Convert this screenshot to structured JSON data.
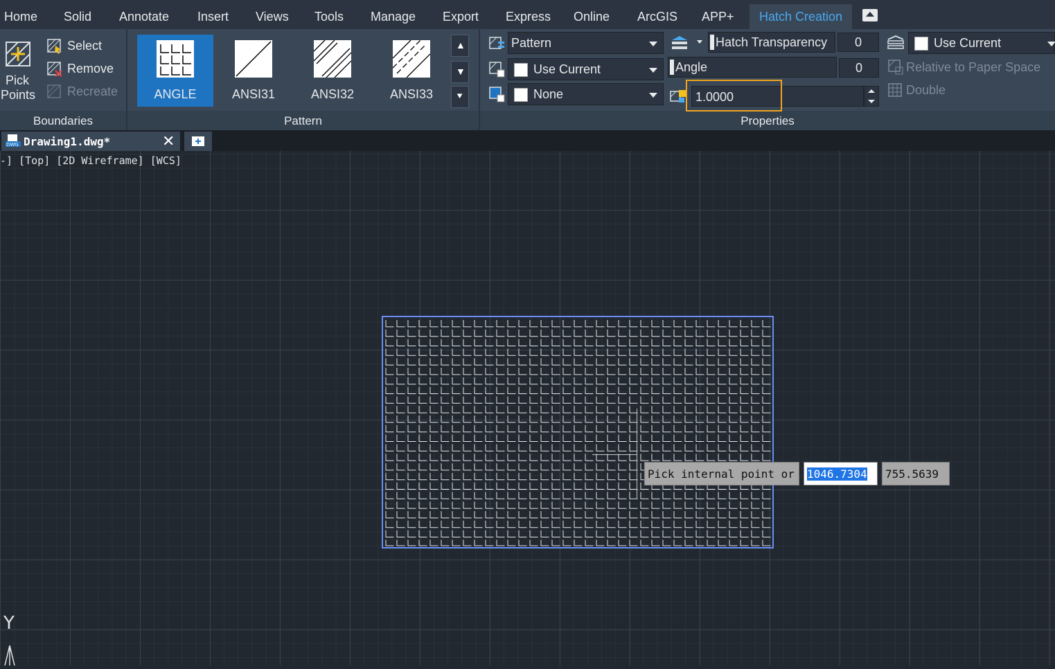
{
  "menu": {
    "items": [
      "Home",
      "Solid",
      "Annotate",
      "Insert",
      "Views",
      "Tools",
      "Manage",
      "Export",
      "Express",
      "Online",
      "ArcGIS",
      "APP+",
      "Hatch Creation"
    ],
    "active": "Hatch Creation"
  },
  "boundaries": {
    "title": "Boundaries",
    "pick_points_line1": "Pick",
    "pick_points_line2": "Points",
    "select": "Select",
    "remove": "Remove",
    "recreate": "Recreate"
  },
  "pattern": {
    "title": "Pattern",
    "tiles": [
      "ANGLE",
      "ANSI31",
      "ANSI32",
      "ANSI33"
    ],
    "selected": "ANGLE"
  },
  "properties": {
    "title": "Properties",
    "hatch_type": "Pattern",
    "hatch_color": "Use Current",
    "background_color": "None",
    "transparency_label": "Hatch Transparency",
    "transparency_value": "0",
    "angle_label": "Angle",
    "angle_value": "0",
    "scale_value": "1.0000",
    "layer": "Use Current",
    "relative_to_paper": "Relative to Paper Space",
    "double": "Double"
  },
  "document": {
    "tab_name": "Drawing1.dwg*",
    "viewport_label": "-] [Top] [2D Wireframe] [WCS]"
  },
  "command": {
    "prompt": "Pick internal point or",
    "x": "1046.7304",
    "y": "755.5639"
  },
  "ucs": {
    "y_label": "Y"
  },
  "colors": {
    "accent": "#1f74c2",
    "active_tab_text": "#4aa8f0",
    "focus_ring": "#f3a51e",
    "hatch_boundary": "#6a8ef5"
  }
}
